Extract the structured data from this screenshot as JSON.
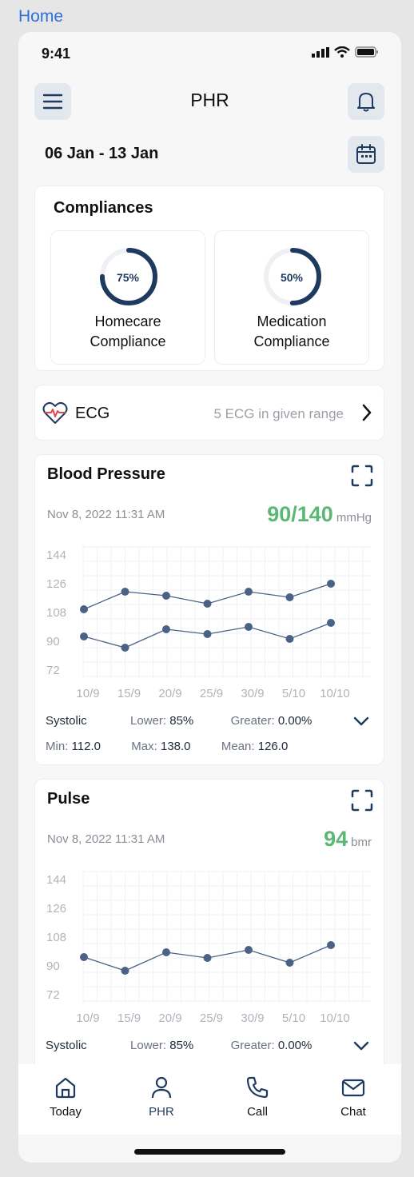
{
  "nav": {
    "back_label": "Home"
  },
  "status_bar": {
    "time": "9:41"
  },
  "header": {
    "title": "PHR",
    "date_range": "06 Jan - 13 Jan"
  },
  "compliances": {
    "title": "Compliances",
    "items": [
      {
        "percent_label": "75%",
        "value": 0.75,
        "label_line1": "Homecare",
        "label_line2": "Compliance"
      },
      {
        "percent_label": "50%",
        "value": 0.5,
        "label_line1": "Medication",
        "label_line2": "Compliance"
      }
    ]
  },
  "ecg": {
    "label": "ECG",
    "info": "5 ECG in given range"
  },
  "blood_pressure": {
    "title": "Blood Pressure",
    "date": "Nov 8, 2022 11:31 AM",
    "value": "90/140",
    "unit": "mmHg",
    "stats": {
      "kind": "Systolic",
      "lower_label": "Lower:",
      "lower": "85%",
      "greater_label": "Greater:",
      "greater": "0.00%",
      "min_label": "Min:",
      "min": "112.0",
      "max_label": "Max:",
      "max": "138.0",
      "mean_label": "Mean:",
      "mean": "126.0"
    }
  },
  "pulse": {
    "title": "Pulse",
    "date": "Nov 8, 2022 11:31 AM",
    "value": "94",
    "unit": "bmr",
    "stats": {
      "kind": "Systolic",
      "lower_label": "Lower:",
      "lower": "85%",
      "greater_label": "Greater:",
      "greater": "0.00%"
    }
  },
  "chart_data": [
    {
      "type": "line",
      "title": "Blood Pressure",
      "y_ticks": [
        "144",
        "126",
        "108",
        "90",
        "72"
      ],
      "x_ticks": [
        "10/9",
        "15/9",
        "20/9",
        "25/9",
        "30/9",
        "5/10",
        "10/10"
      ],
      "ylim": [
        72,
        144
      ],
      "series": [
        {
          "values": [
            110,
            121,
            118.5,
            113.5,
            121,
            117.5,
            126
          ]
        },
        {
          "values": [
            93,
            86,
            97.5,
            94.5,
            99,
            91.5,
            101.5
          ]
        }
      ]
    },
    {
      "type": "line",
      "title": "Pulse",
      "y_ticks": [
        "144",
        "126",
        "108",
        "90",
        "72"
      ],
      "x_ticks": [
        "10/9",
        "15/9",
        "20/9",
        "25/9",
        "30/9",
        "5/10",
        "10/10"
      ],
      "ylim": [
        72,
        144
      ],
      "series": [
        {
          "values": [
            95.5,
            87,
            98.5,
            95,
            100,
            92,
            103
          ]
        }
      ]
    }
  ],
  "tabs": [
    {
      "label": "Today",
      "icon": "home-icon"
    },
    {
      "label": "PHR",
      "icon": "user-icon"
    },
    {
      "label": "Call",
      "icon": "phone-icon"
    },
    {
      "label": "Chat",
      "icon": "mail-icon"
    }
  ],
  "colors": {
    "accent": "#1f3a5f",
    "value_green": "#5bb874",
    "link_blue": "#2f6fdb",
    "ecg_red": "#e04848"
  }
}
